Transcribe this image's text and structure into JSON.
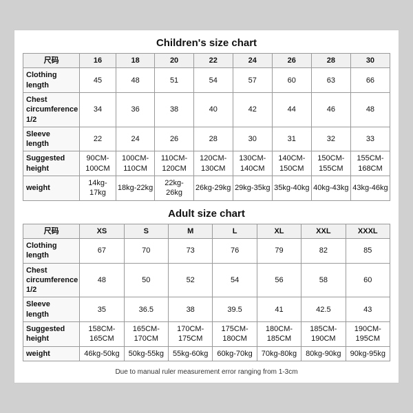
{
  "children": {
    "title": "Children's size chart",
    "columns": [
      "尺码",
      "16",
      "18",
      "20",
      "22",
      "24",
      "26",
      "28",
      "30"
    ],
    "rows": [
      {
        "label": "Clothing\nlength",
        "values": [
          "45",
          "48",
          "51",
          "54",
          "57",
          "60",
          "63",
          "66"
        ]
      },
      {
        "label": "Chest\ncircumference\n1/2",
        "values": [
          "34",
          "36",
          "38",
          "40",
          "42",
          "44",
          "46",
          "48"
        ]
      },
      {
        "label": "Sleeve\nlength",
        "values": [
          "22",
          "24",
          "26",
          "28",
          "30",
          "31",
          "32",
          "33"
        ]
      },
      {
        "label": "Suggested\nheight",
        "values": [
          "90CM-100CM",
          "100CM-110CM",
          "110CM-120CM",
          "120CM-130CM",
          "130CM-140CM",
          "140CM-150CM",
          "150CM-155CM",
          "155CM-168CM"
        ]
      },
      {
        "label": "weight",
        "values": [
          "14kg-17kg",
          "18kg-22kg",
          "22kg-26kg",
          "26kg-29kg",
          "29kg-35kg",
          "35kg-40kg",
          "40kg-43kg",
          "43kg-46kg"
        ]
      }
    ]
  },
  "adult": {
    "title": "Adult size chart",
    "columns": [
      "尺码",
      "XS",
      "S",
      "M",
      "L",
      "XL",
      "XXL",
      "XXXL"
    ],
    "rows": [
      {
        "label": "Clothing\nlength",
        "values": [
          "67",
          "70",
          "73",
          "76",
          "79",
          "82",
          "85"
        ]
      },
      {
        "label": "Chest\ncircumference\n1/2",
        "values": [
          "48",
          "50",
          "52",
          "54",
          "56",
          "58",
          "60"
        ]
      },
      {
        "label": "Sleeve\nlength",
        "values": [
          "35",
          "36.5",
          "38",
          "39.5",
          "41",
          "42.5",
          "43"
        ]
      },
      {
        "label": "Suggested\nheight",
        "values": [
          "158CM-165CM",
          "165CM-170CM",
          "170CM-175CM",
          "175CM-180CM",
          "180CM-185CM",
          "185CM-190CM",
          "190CM-195CM"
        ]
      },
      {
        "label": "weight",
        "values": [
          "46kg-50kg",
          "50kg-55kg",
          "55kg-60kg",
          "60kg-70kg",
          "70kg-80kg",
          "80kg-90kg",
          "90kg-95kg"
        ]
      }
    ]
  },
  "note": "Due to manual ruler measurement error ranging from 1-3cm"
}
